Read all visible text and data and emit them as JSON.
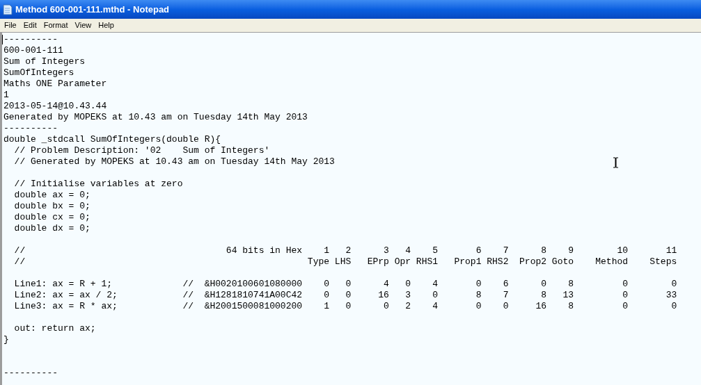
{
  "window": {
    "title": "Method 600-001-111.mthd - Notepad"
  },
  "menu": [
    "File",
    "Edit",
    "Format",
    "View",
    "Help"
  ],
  "document": {
    "header_lines": [
      "----------",
      "600-001-111",
      "Sum of Integers",
      "SumOfIntegers",
      "Maths ONE Parameter",
      "1",
      "2013-05-14@10.43.44",
      "Generated by MOPEKS at 10.43 am on Tuesday 14th May 2013",
      "----------",
      "double _stdcall SumOfIntegers(double R){",
      "  // Problem Description: '02    Sum of Integers'",
      "  // Generated by MOPEKS at 10.43 am on Tuesday 14th May 2013"
    ],
    "init_lines": [
      "  // Initialise variables at zero",
      "  double ax = 0;",
      "  double bx = 0;",
      "  double cx = 0;",
      "  double dx = 0;"
    ],
    "table": {
      "comment_marks": [
        "//",
        "//"
      ],
      "hex_heading": "64 bits in Hex",
      "column_numbers": [
        "1",
        "2",
        "3",
        "4",
        "5",
        "6",
        "7",
        "8",
        "9",
        "10",
        "11"
      ],
      "column_labels": [
        "Type",
        "LHS",
        "EPrp",
        "Opr",
        "RHS1",
        "Prop1",
        "RHS2",
        "Prop2",
        "Goto",
        "Method",
        "Steps"
      ],
      "rows": [
        {
          "code": "Line1: ax = R + 1;",
          "comment_mark": "//",
          "hex": "&H0020100601080000",
          "values": [
            "0",
            "0",
            "4",
            "0",
            "4",
            "0",
            "6",
            "0",
            "8",
            "0",
            "0"
          ]
        },
        {
          "code": "Line2: ax = ax / 2;",
          "comment_mark": "//",
          "hex": "&H1281810741A00C42",
          "values": [
            "0",
            "0",
            "16",
            "3",
            "0",
            "8",
            "7",
            "8",
            "13",
            "0",
            "33"
          ]
        },
        {
          "code": "Line3: ax = R * ax;",
          "comment_mark": "//",
          "hex": "&H2001500081000200",
          "values": [
            "1",
            "0",
            "0",
            "2",
            "4",
            "0",
            "0",
            "16",
            "8",
            "0",
            "0"
          ]
        }
      ]
    },
    "closing_lines": [
      "  out: return ax;",
      "}"
    ],
    "footer_line": "----------"
  }
}
